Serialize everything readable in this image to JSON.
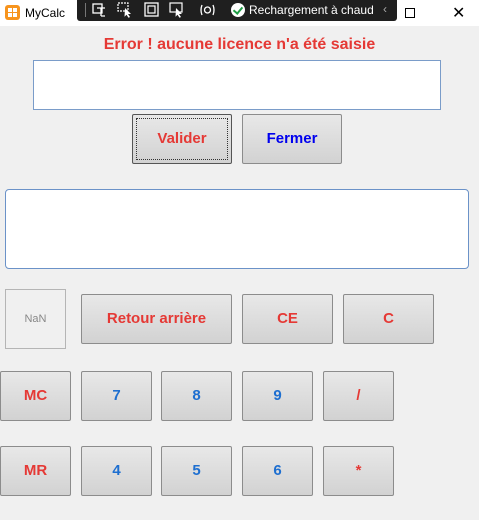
{
  "window": {
    "title": "MyCalc",
    "debug_toolbar": {
      "hot_reload_label": "Rechargement à chaud",
      "collapse_glyph": "‹"
    },
    "close_glyph": "✕"
  },
  "error_message": "Error ! aucune licence n'a été saisie",
  "license_input": {
    "value": ""
  },
  "license_buttons": {
    "validate_label": "Valider",
    "close_label": "Fermer"
  },
  "display": {
    "value": ""
  },
  "nan_label": "NaN",
  "keypad": {
    "row1": [
      "Retour arrière",
      "CE",
      "C"
    ],
    "row2": [
      "MC",
      "7",
      "8",
      "9",
      "/"
    ],
    "row3": [
      "MR",
      "4",
      "5",
      "6",
      "*"
    ]
  },
  "colors": {
    "error_red": "#e53935",
    "digit_blue": "#1e6fd0",
    "close_blue": "#0000ee",
    "app_icon": "#f7941d"
  }
}
